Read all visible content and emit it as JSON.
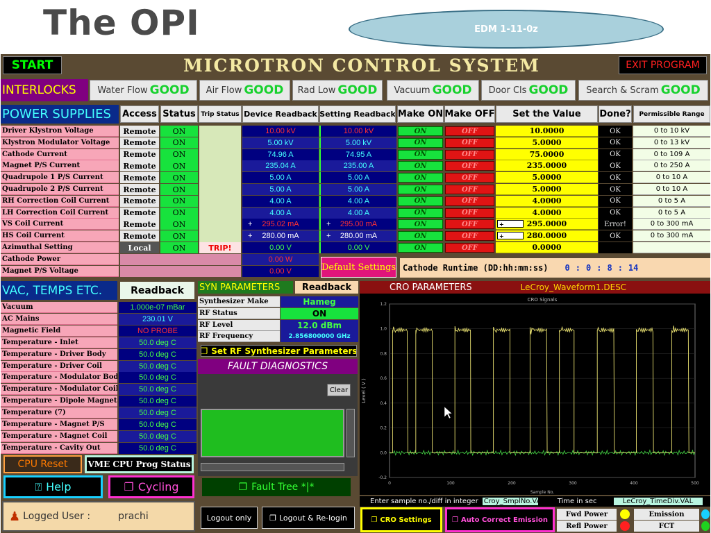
{
  "slide_title": "The OPI",
  "edm_label": "EDM  1-11-0z",
  "header": {
    "start": "START",
    "title": "MICROTRON  CONTROL  SYSTEM",
    "exit": "EXIT PROGRAM"
  },
  "interlocks": {
    "label": "INTERLOCKS",
    "items": [
      {
        "name": "Water Flow",
        "status": "GOOD"
      },
      {
        "name": "Air Flow",
        "status": "GOOD"
      },
      {
        "name": "Rad Low",
        "status": "GOOD"
      },
      {
        "name": "Vacuum",
        "status": "GOOD"
      },
      {
        "name": "Door Cls",
        "status": "GOOD"
      },
      {
        "name": "Search & Scram",
        "status": "GOOD"
      }
    ]
  },
  "power": {
    "label": "POWER SUPPLIES",
    "cols": [
      "Access",
      "Status",
      "Trip Status",
      "Device Readback",
      "Setting Readback",
      "Make ON",
      "Make OFF",
      "Set the Value",
      "Done?",
      "Permissible Range"
    ],
    "rows": [
      {
        "name": "Driver Klystron Voltage",
        "access": "Remote",
        "status": "ON",
        "dev": "10.00 kV",
        "set": "10.00 kV",
        "value": "10.0000",
        "done": "OK",
        "range": "0 to 10 kV",
        "devc": "#ff3030",
        "setc": "#ff3030"
      },
      {
        "name": "Klystron Modulator Voltage",
        "access": "Remote",
        "status": "ON",
        "dev": "5.00 kV",
        "set": "5.00 kV",
        "value": "5.0000",
        "done": "OK",
        "range": "0 to 13 kV",
        "devc": "#4ff",
        "setc": "#4ff"
      },
      {
        "name": "Cathode Current",
        "access": "Remote",
        "status": "ON",
        "dev": "74.96 A",
        "set": "74.95 A",
        "value": "75.0000",
        "done": "OK",
        "range": "0 to 109 A",
        "devc": "#4ff",
        "setc": "#4ff"
      },
      {
        "name": "Magnet P/S Current",
        "access": "Remote",
        "status": "ON",
        "dev": "235.04 A",
        "set": "235.00 A",
        "value": "235.0000",
        "done": "OK",
        "range": "0 to 250 A",
        "devc": "#4ff",
        "setc": "#4ff"
      },
      {
        "name": "Quadrupole 1 P/S Current",
        "access": "Remote",
        "status": "ON",
        "dev": "5.00 A",
        "set": "5.00 A",
        "value": "5.0000",
        "done": "OK",
        "range": "0 to 10 A",
        "devc": "#4ff",
        "setc": "#4ff"
      },
      {
        "name": "Quadrupole 2 P/S Current",
        "access": "Remote",
        "status": "ON",
        "dev": "5.00 A",
        "set": "5.00 A",
        "value": "5.0000",
        "done": "OK",
        "range": "0 to 10 A",
        "devc": "#4ff",
        "setc": "#4ff"
      },
      {
        "name": "RH Correction Coil Current",
        "access": "Remote",
        "status": "ON",
        "dev": "4.00 A",
        "set": "4.00 A",
        "value": "4.0000",
        "done": "OK",
        "range": "0 to 5 A",
        "devc": "#4ff",
        "setc": "#4ff"
      },
      {
        "name": "LH Correction Coil Current",
        "access": "Remote",
        "status": "ON",
        "dev": "4.00 A",
        "set": "4.00 A",
        "value": "4.0000",
        "done": "OK",
        "range": "0 to 5 A",
        "devc": "#4ff",
        "setc": "#4ff"
      },
      {
        "name": "VS Coil Current",
        "access": "Remote",
        "status": "ON",
        "dev": "295.02 mA",
        "set": "295.00 mA",
        "value": "295.0000",
        "done": "Error!",
        "range": "0 to 300 mA",
        "devc": "#ff3030",
        "setc": "#ff3030",
        "pm": "+"
      },
      {
        "name": "HS Coil Current",
        "access": "Remote",
        "status": "ON",
        "dev": "280.00 mA",
        "set": "280.00 mA",
        "value": "280.0000",
        "done": "OK",
        "range": "0 to 300 mA",
        "devc": "#fff",
        "setc": "#fff",
        "pm": "+"
      },
      {
        "name": "Azimuthal Setting",
        "access": "Local",
        "status": "ON",
        "trip": "TRIP!",
        "dev": "0.00 V",
        "set": "0.00 V",
        "value": "0.0000",
        "done": "",
        "range": "",
        "devc": "#4f4",
        "setc": "#4f4"
      },
      {
        "name": "Cathode Power",
        "dev": "0.00 W",
        "devc": "#ff3030"
      },
      {
        "name": "Magnet P/S Voltage",
        "dev": "0.00 V",
        "devc": "#ff3030"
      }
    ],
    "on_label": "ON",
    "off_label": "OFF",
    "plus_label": "+",
    "default_btn": "Default Settings",
    "runtime_label": "Cathode Runtime (DD:hh:mm:ss)",
    "runtime": [
      "0",
      ":",
      "0",
      ":",
      "8",
      ":",
      "14"
    ]
  },
  "vac": {
    "label": "VAC, TEMPS ETC.",
    "readback": "Readback",
    "rows": [
      {
        "name": "Vacuum",
        "value": "1.000e-07 mBar",
        "color": "#4f4"
      },
      {
        "name": "AC Mains",
        "value": "230.01  V",
        "color": "#4ff"
      },
      {
        "name": "Magnetic Field",
        "value": "NO PROBE",
        "color": "#ff3030"
      },
      {
        "name": "Temperature - Inlet",
        "value": "50.0  deg C",
        "color": "#4f4"
      },
      {
        "name": "Temperature - Driver Body",
        "value": "50.0  deg C",
        "color": "#4f4"
      },
      {
        "name": "Temperature - Driver Coil",
        "value": "50.0  deg C",
        "color": "#4f4"
      },
      {
        "name": "Temperature - Modulator Body",
        "value": "50.0  deg C",
        "color": "#4f4"
      },
      {
        "name": "Temperature - Modulator Coil",
        "value": "50.0  deg C",
        "color": "#4f4"
      },
      {
        "name": "Temperature - Dipole Magnet",
        "value": "50.0  deg C",
        "color": "#4f4"
      },
      {
        "name": "Temperature (7)",
        "value": "50.0  deg C",
        "color": "#4f4"
      },
      {
        "name": "Temperature - Magnet P/S",
        "value": "50.0  deg C",
        "color": "#4f4"
      },
      {
        "name": "Temperature - Magnet Coil",
        "value": "50.0  deg C",
        "color": "#4f4"
      },
      {
        "name": "Temperature - Cavity Out",
        "value": "50.0  deg C",
        "color": "#4f4"
      }
    ]
  },
  "syn": {
    "label": "SYN PARAMETERS",
    "readback": "Readback",
    "rows": [
      {
        "name": "Synthesizer Make",
        "value": "Hameg"
      },
      {
        "name": "RF Status",
        "value": "ON"
      },
      {
        "name": "RF Level",
        "value": "12.0     dBm"
      },
      {
        "name": "RF Frequency",
        "value": "2.856800000  GHz"
      }
    ],
    "set_btn": "Set RF Synthesizer Parameters"
  },
  "fault": {
    "label": "FAULT DIAGNOSTICS",
    "clear": "Clear",
    "tree": "Fault Tree  *|*"
  },
  "cro": {
    "label": "CRO PARAMETERS",
    "file": "LeCroy_Waveform1.DESC",
    "sample_label": "Enter sample no./diff in integer",
    "sample_field": "Croy_SmplNo.VA",
    "time_label": "Time in sec",
    "time_field": "LeCroy_TimeDiv.VAL",
    "settings_btn": "CRO Settings",
    "auto_btn": "Auto Correct Emission",
    "fwd": "Fwd Power",
    "refl": "Refl Power",
    "emission": "Emission",
    "fct": "FCT"
  },
  "bottom": {
    "cpu_reset": "CPU Reset",
    "vme": "VME CPU Prog Status",
    "help": "Help",
    "cycling": "Cycling",
    "logged_label": "Logged User :",
    "user": "prachi",
    "logout": "Logout only",
    "relogin": "Logout & Re-login"
  },
  "chart_data": {
    "type": "line",
    "title": "CRO Signals",
    "xlabel": "Sample No.",
    "ylabel": "Level ( V )",
    "xlim": [
      0,
      500
    ],
    "ylim": [
      -0.2,
      1.2
    ],
    "xticks": [
      0,
      100,
      200,
      300,
      400,
      500
    ],
    "yticks": [
      -0.2,
      0.0,
      0.2,
      0.4,
      0.6,
      0.8,
      1.0,
      1.2
    ],
    "series": [
      {
        "color": "#e8e070",
        "pulses": [
          [
            5,
            30
          ],
          [
            43,
            70
          ],
          [
            107,
            133
          ],
          [
            170,
            197
          ],
          [
            230,
            258
          ],
          [
            278,
            302
          ],
          [
            340,
            368
          ],
          [
            404,
            432
          ],
          [
            462,
            490
          ]
        ],
        "high": 0.99,
        "low": 0.0
      },
      {
        "color": "#3fd23f",
        "level": 0.0
      }
    ]
  },
  "colors": {
    "panel": "#5a4a33",
    "bluebar": "#0a2a8a",
    "green": "#17e23d",
    "yellow": "#ffff00"
  }
}
